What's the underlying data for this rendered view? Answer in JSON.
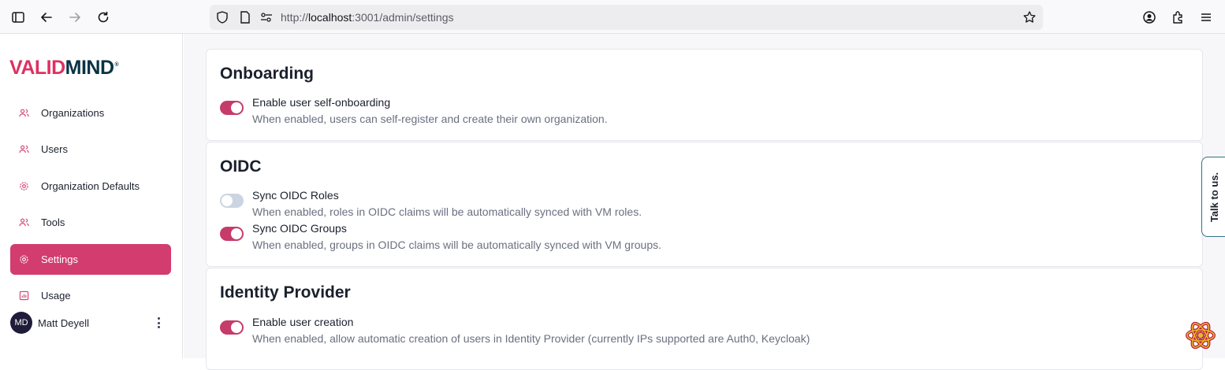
{
  "browser": {
    "url_prefix": "http://",
    "url_host": "localhost",
    "url_rest": ":3001/admin/settings"
  },
  "logo": {
    "v": "V",
    "alid": "ALID",
    "mind": "MIND",
    "reg": "®"
  },
  "sidebar": {
    "items": [
      {
        "label": "Organizations",
        "icon": "users-icon"
      },
      {
        "label": "Users",
        "icon": "users-icon"
      },
      {
        "label": "Organization Defaults",
        "icon": "gear-icon"
      },
      {
        "label": "Tools",
        "icon": "users-icon"
      },
      {
        "label": "Settings",
        "icon": "gear-icon"
      },
      {
        "label": "Usage",
        "icon": "chart-icon"
      }
    ],
    "user": {
      "initials": "MD",
      "name": "Matt Deyell"
    }
  },
  "sections": {
    "onboarding": {
      "title": "Onboarding",
      "settings": [
        {
          "title": "Enable user self-onboarding",
          "desc": "When enabled, users can self-register and create their own organization.",
          "enabled": true
        }
      ]
    },
    "oidc": {
      "title": "OIDC",
      "settings": [
        {
          "title": "Sync OIDC Roles",
          "desc": "When enabled, roles in OIDC claims will be automatically synced with VM roles.",
          "enabled": false
        },
        {
          "title": "Sync OIDC Groups",
          "desc": "When enabled, groups in OIDC claims will be automatically synced with VM groups.",
          "enabled": true
        }
      ]
    },
    "identity": {
      "title": "Identity Provider",
      "settings": [
        {
          "title": "Enable user creation",
          "desc": "When enabled, allow automatic creation of users in Identity Provider (currently IPs supported are Auth0, Keycloak)",
          "enabled": true
        }
      ]
    }
  },
  "feedback": {
    "label": "Talk to us."
  },
  "colors": {
    "accent": "#d23c6e",
    "toggle_on": "#c53b6a",
    "toggle_off": "#cbd5e1"
  }
}
